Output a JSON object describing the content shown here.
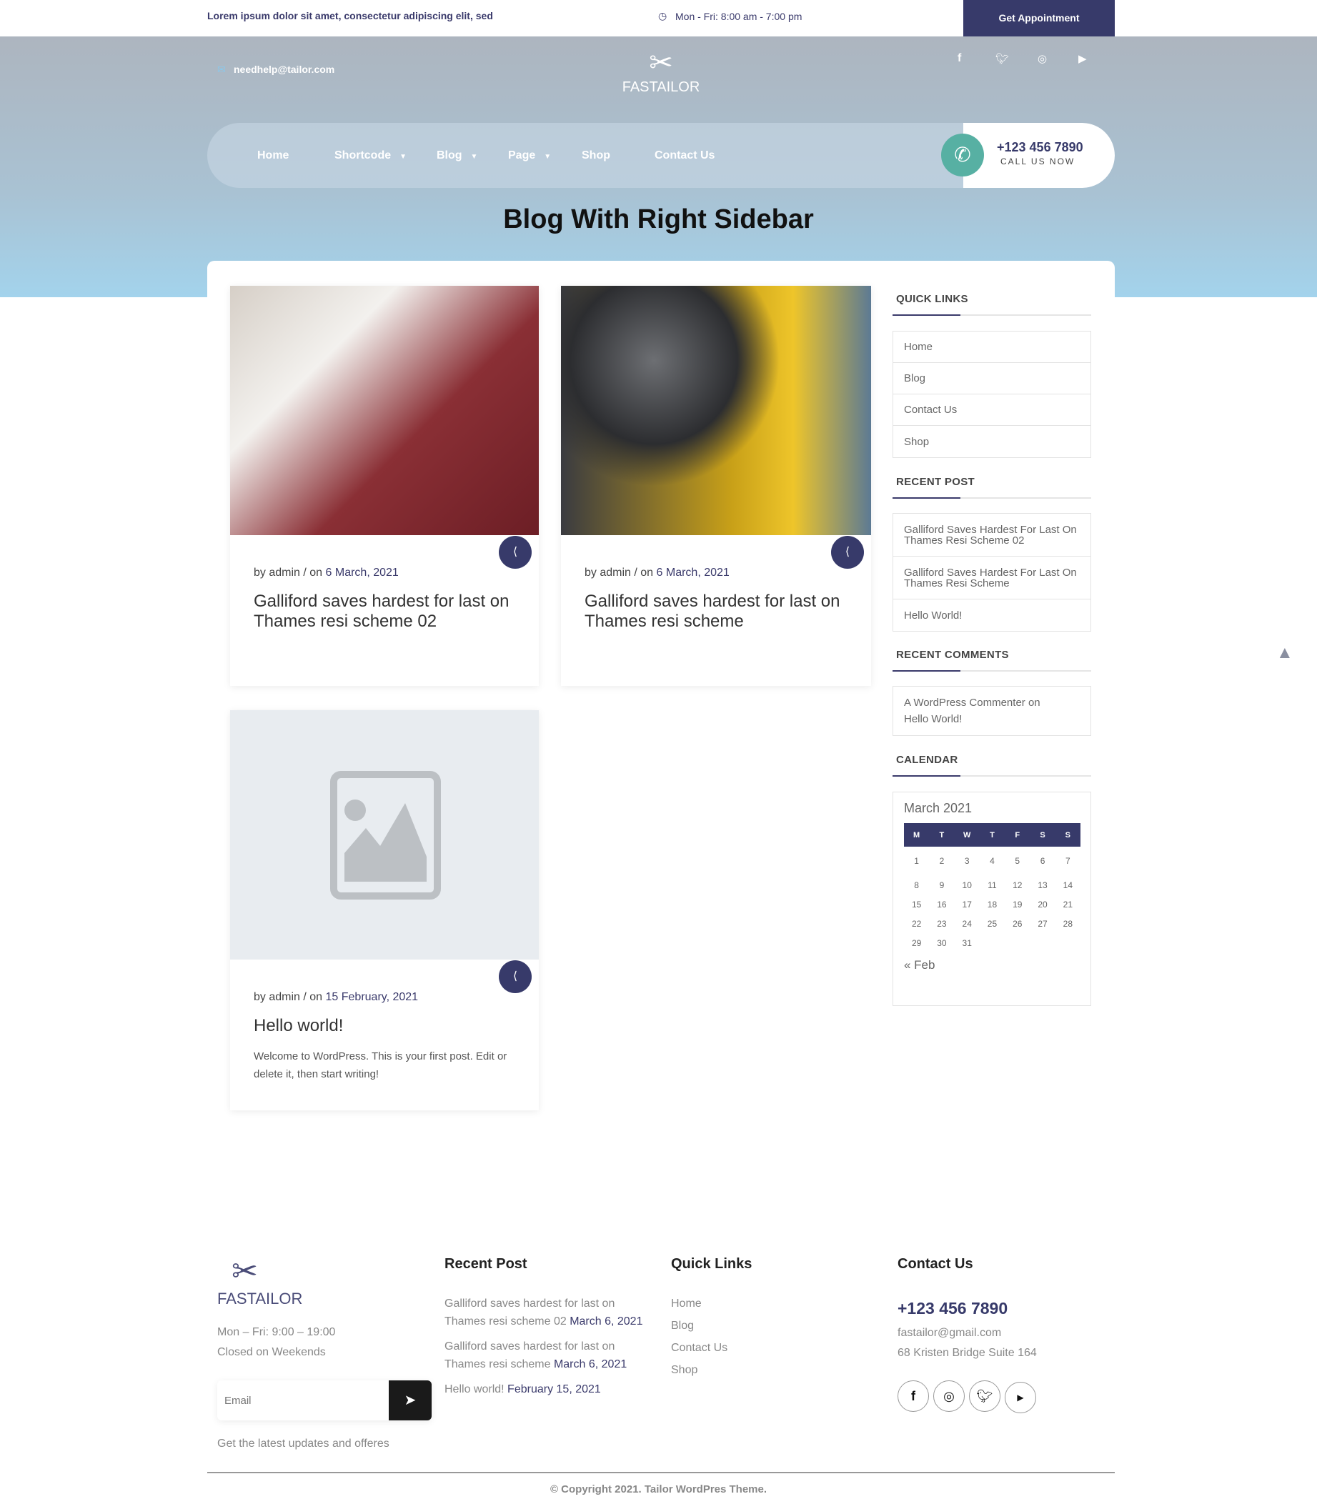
{
  "topbar": {
    "tagline": "Lorem ipsum dolor sit amet, consectetur adipiscing elit, sed",
    "hours": "Mon - Fri: 8:00 am - 7:00 pm",
    "appointment": "Get Appointment"
  },
  "header": {
    "email": "needhelp@tailor.com",
    "logo": "FASTAILOR",
    "social": [
      "facebook-icon",
      "twitter-icon",
      "instagram-icon",
      "youtube-icon"
    ]
  },
  "nav": {
    "items": [
      {
        "label": "Home"
      },
      {
        "label": "Shortcode",
        "dropdown": true
      },
      {
        "label": "Blog",
        "dropdown": true
      },
      {
        "label": "Page",
        "dropdown": true
      },
      {
        "label": "Shop"
      },
      {
        "label": "Contact Us"
      }
    ],
    "phone": "+123 456 7890",
    "call_label": "CALL US NOW"
  },
  "page_title": "Blog With Right Sidebar",
  "posts": [
    {
      "by": "by admin",
      "on": "/ on",
      "date": "6 March, 2021",
      "title": "Galliford saves hardest for last on Thames resi scheme 02",
      "excerpt": ""
    },
    {
      "by": "by admin",
      "on": "/ on",
      "date": "6 March, 2021",
      "title": "Galliford saves hardest for last on Thames resi scheme",
      "excerpt": ""
    },
    {
      "by": "by admin",
      "on": "/ on",
      "date": "15 February, 2021",
      "title": "Hello world!",
      "excerpt": "Welcome to WordPress. This is your first post. Edit or delete it, then start writing!"
    }
  ],
  "sidebar": {
    "quick_links": {
      "title": "QUICK LINKS",
      "items": [
        "Home",
        "Blog",
        "Contact Us",
        "Shop"
      ]
    },
    "recent_post": {
      "title": "RECENT POST",
      "items": [
        "Galliford Saves Hardest For Last On Thames Resi Scheme 02",
        "Galliford Saves Hardest For Last On Thames Resi Scheme",
        "Hello World!"
      ]
    },
    "recent_comments": {
      "title": "RECENT COMMENTS",
      "text": "A WordPress Commenter on Hello World!"
    },
    "calendar": {
      "title": "CALENDAR",
      "month": "March 2021",
      "days": [
        "M",
        "T",
        "W",
        "T",
        "F",
        "S",
        "S"
      ],
      "weeks": [
        [
          "1",
          "2",
          "3",
          "4",
          "5",
          "6",
          "7"
        ],
        [
          "8",
          "9",
          "10",
          "11",
          "12",
          "13",
          "14"
        ],
        [
          "15",
          "16",
          "17",
          "18",
          "19",
          "20",
          "21"
        ],
        [
          "22",
          "23",
          "24",
          "25",
          "26",
          "27",
          "28"
        ],
        [
          "29",
          "30",
          "31",
          "",
          "",
          "",
          ""
        ]
      ],
      "prev": "« Feb"
    }
  },
  "footer": {
    "logo": "FASTAILOR",
    "hours": "Mon – Fri: 9:00 – 19:00",
    "closed": "Closed on Weekends",
    "email_placeholder": "Email",
    "newsletter_note": "Get the latest updates and offeres",
    "recent_title": "Recent Post",
    "recent": [
      {
        "text": "Galliford saves hardest for last on Thames resi scheme 02",
        "date": "March 6, 2021"
      },
      {
        "text": "Galliford saves hardest for last on Thames resi scheme",
        "date": "March 6, 2021"
      },
      {
        "text": "Hello world!",
        "date": "February 15, 2021"
      }
    ],
    "links_title": "Quick Links",
    "links": [
      "Home",
      "Blog",
      "Contact Us",
      "Shop"
    ],
    "contact_title": "Contact Us",
    "phone": "+123 456 7890",
    "email": "fastailor@gmail.com",
    "address": "68 Kristen Bridge Suite 164",
    "social": [
      "facebook-icon",
      "instagram-icon",
      "twitter-icon",
      "youtube-icon"
    ],
    "copyright": "© Copyright 2021. Tailor WordPres Theme."
  },
  "colors": {
    "primary": "#373a6a",
    "accent": "#57b0a3"
  }
}
